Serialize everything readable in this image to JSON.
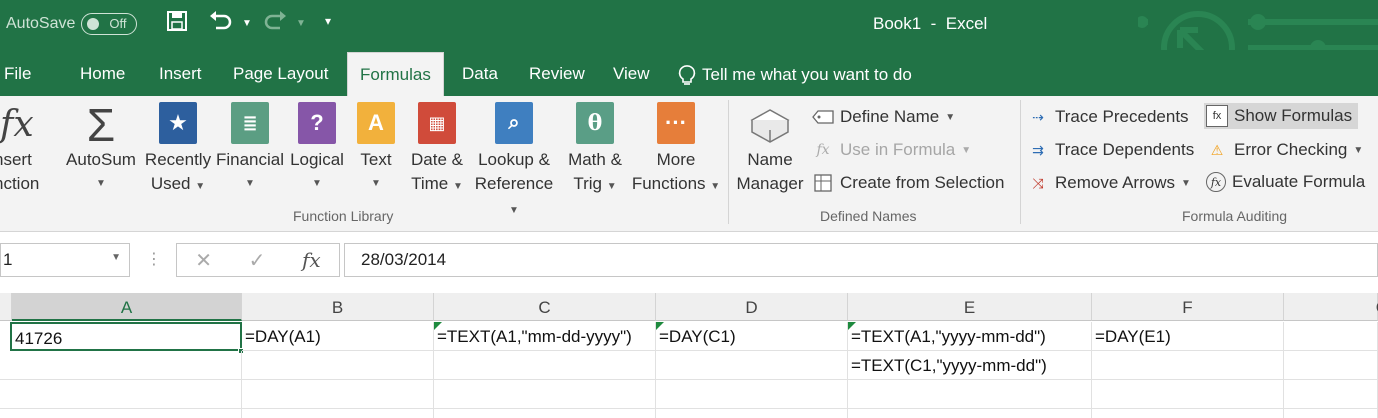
{
  "titlebar": {
    "autosave_label": "AutoSave",
    "autosave_state": "Off",
    "title": "Book1  -  Excel",
    "brand_color": "#217346"
  },
  "tabs": [
    {
      "label": "File"
    },
    {
      "label": "Home"
    },
    {
      "label": "Insert"
    },
    {
      "label": "Page Layout"
    },
    {
      "label": "Formulas",
      "active": true
    },
    {
      "label": "Data"
    },
    {
      "label": "Review"
    },
    {
      "label": "View"
    }
  ],
  "tellme": "Tell me what you want to do",
  "ribbon": {
    "insert_function": [
      "nsert",
      "nction"
    ],
    "autosum": "AutoSum",
    "recently": [
      "Recently",
      "Used"
    ],
    "financial": "Financial",
    "logical": "Logical",
    "text": "Text",
    "datetime": [
      "Date &",
      "Time"
    ],
    "lookup": [
      "Lookup &",
      "Reference"
    ],
    "math": [
      "Math &",
      "Trig"
    ],
    "more": [
      "More",
      "Functions"
    ],
    "group_function_library": "Function Library",
    "name_manager": [
      "Name",
      "Manager"
    ],
    "define_name": "Define Name",
    "use_in_formula": "Use in Formula",
    "create_from_selection": "Create from Selection",
    "group_defined_names": "Defined Names",
    "trace_precedents": "Trace Precedents",
    "trace_dependents": "Trace Dependents",
    "remove_arrows": "Remove Arrows",
    "show_formulas": "Show Formulas",
    "error_checking": "Error Checking",
    "evaluate_formula": "Evaluate Formula",
    "group_formula_auditing": "Formula Auditing"
  },
  "formula_bar": {
    "name_box": "1",
    "value": "28/03/2014"
  },
  "columns": [
    "A",
    "B",
    "C",
    "D",
    "E",
    "F",
    "G"
  ],
  "cells": {
    "A1": "41726",
    "B1": "=DAY(A1)",
    "C1": "=TEXT(A1,\"mm-dd-yyyy\")",
    "D1": "=DAY(C1)",
    "E1": "=TEXT(A1,\"yyyy-mm-dd\")",
    "F1": "=DAY(E1)",
    "E2": "=TEXT(C1,\"yyyy-mm-dd\")"
  }
}
